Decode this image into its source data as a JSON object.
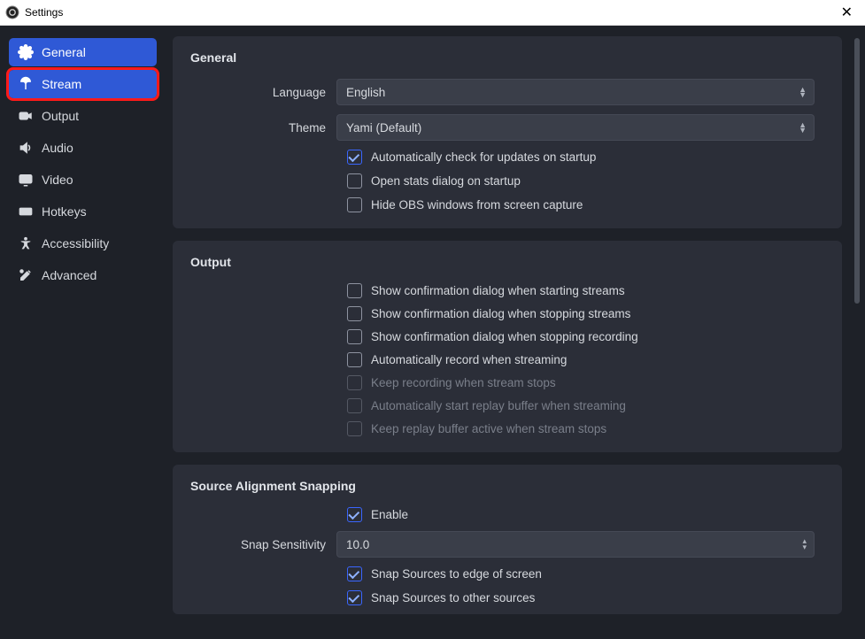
{
  "window": {
    "title": "Settings"
  },
  "sidebar": {
    "items": [
      {
        "label": "General",
        "key": "general",
        "selected": true,
        "highlighted": false
      },
      {
        "label": "Stream",
        "key": "stream",
        "selected": false,
        "highlighted": true
      },
      {
        "label": "Output",
        "key": "output",
        "selected": false,
        "highlighted": false
      },
      {
        "label": "Audio",
        "key": "audio",
        "selected": false,
        "highlighted": false
      },
      {
        "label": "Video",
        "key": "video",
        "selected": false,
        "highlighted": false
      },
      {
        "label": "Hotkeys",
        "key": "hotkeys",
        "selected": false,
        "highlighted": false
      },
      {
        "label": "Accessibility",
        "key": "accessibility",
        "selected": false,
        "highlighted": false
      },
      {
        "label": "Advanced",
        "key": "advanced",
        "selected": false,
        "highlighted": false
      }
    ]
  },
  "groups": {
    "general": {
      "title": "General",
      "language_label": "Language",
      "language_value": "English",
      "theme_label": "Theme",
      "theme_value": "Yami (Default)",
      "checks": [
        {
          "label": "Automatically check for updates on startup",
          "checked": true,
          "disabled": false
        },
        {
          "label": "Open stats dialog on startup",
          "checked": false,
          "disabled": false
        },
        {
          "label": "Hide OBS windows from screen capture",
          "checked": false,
          "disabled": false
        }
      ]
    },
    "output": {
      "title": "Output",
      "checks": [
        {
          "label": "Show confirmation dialog when starting streams",
          "checked": false,
          "disabled": false
        },
        {
          "label": "Show confirmation dialog when stopping streams",
          "checked": false,
          "disabled": false
        },
        {
          "label": "Show confirmation dialog when stopping recording",
          "checked": false,
          "disabled": false
        },
        {
          "label": "Automatically record when streaming",
          "checked": false,
          "disabled": false
        },
        {
          "label": "Keep recording when stream stops",
          "checked": false,
          "disabled": true
        },
        {
          "label": "Automatically start replay buffer when streaming",
          "checked": false,
          "disabled": true
        },
        {
          "label": "Keep replay buffer active when stream stops",
          "checked": false,
          "disabled": true
        }
      ]
    },
    "snapping": {
      "title": "Source Alignment Snapping",
      "sensitivity_label": "Snap Sensitivity",
      "sensitivity_value": "10.0",
      "checks_top": {
        "label": "Enable",
        "checked": true
      },
      "checks_bottom": [
        {
          "label": "Snap Sources to edge of screen",
          "checked": true
        },
        {
          "label": "Snap Sources to other sources",
          "checked": true
        }
      ]
    }
  }
}
